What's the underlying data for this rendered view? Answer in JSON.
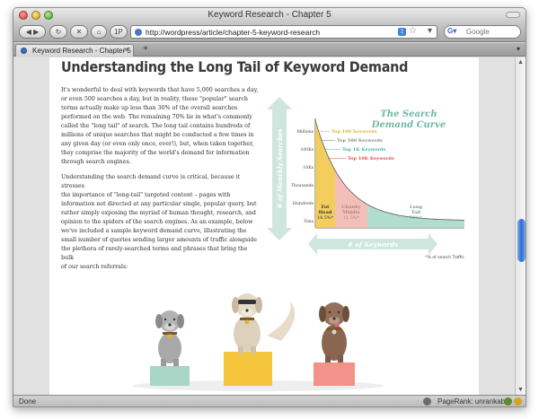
{
  "window": {
    "title": "Keyword Research - Chapter 5"
  },
  "toolbar": {
    "url": "http://wordpress/article/chapter-5-keyword-research",
    "pr_label": "1P",
    "search_placeholder": "Google"
  },
  "tabs": [
    {
      "label": "Keyword Research - Chapter 5"
    }
  ],
  "article": {
    "heading": "Understanding the Long Tail of Keyword Demand",
    "para1_lines": [
      "It's wonderful to deal with keywords that have 5,000 searches a day,",
      "or even 500 searches a day, but in reality, these \"popular\" search",
      "terms actually make up less than 30% of the overall searches",
      "performed on the web. The remaining 70% lie in what's commonly",
      "called the \"long tail\" of search. The long tail contains hundreds of",
      "millions of unique searches that might be conducted a few times in",
      "any given day (or even only once, ever!), but, when taken together,",
      "they comprise the majority of the world's demand for information",
      "through search engines."
    ],
    "para2_lines": [
      "Understanding the search demand curve is critical, because it stresses",
      "the importance of \"long-tail\" targeted content – pages with",
      "information not directed at any particular single, popular query, but",
      "rather simply exposing the myriad of human thought, research, and",
      "opinion to the spiders of the search engines. As an example, below",
      "we've included a sample keyword demand curve, illustrating the",
      "small number of queries sending larger amounts of traffic alongside",
      "the plethora of rarely-searched terms and phrases that bring the bulk",
      "of our search referrals:"
    ]
  },
  "chart_data": {
    "type": "area",
    "title": "The Search Demand Curve",
    "ylabel": "# of Monthly Searches",
    "xlabel": "# of Keywords",
    "y_ticks": [
      "Millions",
      "100Ks",
      "10Ks",
      "Thousands",
      "Hundreds",
      "Tens"
    ],
    "annotations": [
      {
        "label": "Top 100 Keywords",
        "color": "#e6b52e"
      },
      {
        "label": "Top 500 Keywords",
        "color": "#8c8c8c"
      },
      {
        "label": "Top 1K Keywords",
        "color": "#4bb39a"
      },
      {
        "label": "Top 10K Keywords",
        "color": "#e0514e"
      }
    ],
    "segments": [
      {
        "name": "Fat Head",
        "percent": "18.5%*",
        "color": "#f2c94c"
      },
      {
        "name": "Chunky Middle",
        "percent": "11.5%*",
        "color": "#f3b8b0"
      },
      {
        "name": "Long Tail",
        "percent": "70%*",
        "color": "#a9d8cb"
      }
    ],
    "footnote": "*% of search Traffic"
  },
  "statusbar": {
    "status": "Done",
    "pagerank": "PageRank: unrankable"
  },
  "colors": {
    "teal": "#9fcfc3",
    "heading": "#3a3a3a",
    "title_teal": "#6fb8a4"
  }
}
